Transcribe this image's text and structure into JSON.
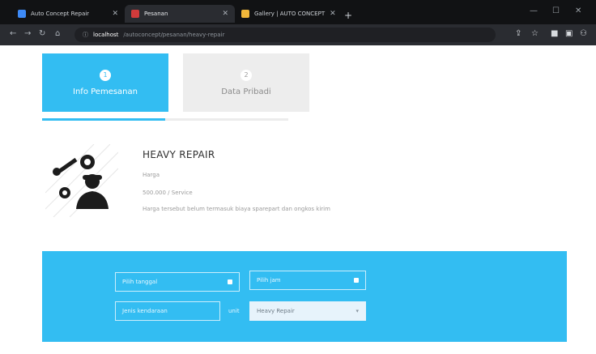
{
  "browser": {
    "tabs": [
      {
        "title": "Auto Concept Repair",
        "active": false,
        "favicon_color": "#3d8af7"
      },
      {
        "title": "Pesanan",
        "active": true,
        "favicon_color": "#d23b3b"
      },
      {
        "title": "Gallery | AUTO CONCEPT",
        "active": false,
        "favicon_color": "#f1b73a"
      }
    ],
    "new_tab_label": "+",
    "url_host": "localhost",
    "url_path": "/autoconcept/pesanan/heavy-repair",
    "window_controls": {
      "minimize": "—",
      "maximize": "☐",
      "close": "✕"
    }
  },
  "steps": [
    {
      "number": "1",
      "label": "Info Pemesanan",
      "active": true
    },
    {
      "number": "2",
      "label": "Data Pribadi",
      "active": false
    }
  ],
  "progress": {
    "completed_fraction": 0.5
  },
  "service": {
    "title": "HEAVY REPAIR",
    "price_label": "Harga",
    "price_value": "500.000 / Service",
    "note": "Harga tersebut belum termasuk biaya sparepart dan ongkos kirim"
  },
  "form": {
    "date_field": "Pilih tanggal",
    "time_field": "Pilih jam",
    "vehicle_field": "Jenis kendaraan",
    "unit_label": "unit",
    "service_selected": "Heavy Repair"
  },
  "colors": {
    "accent": "#33bdf2",
    "chrome": "#111214"
  }
}
